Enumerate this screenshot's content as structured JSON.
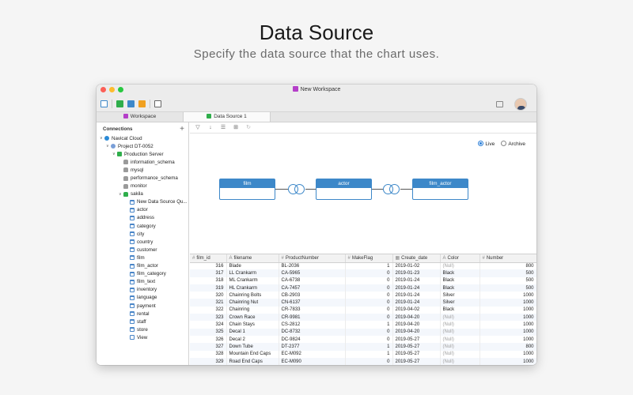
{
  "hero": {
    "title": "Data Source",
    "subtitle": "Specify the data source that the chart uses."
  },
  "window": {
    "title": "New Workspace",
    "tabs": [
      {
        "label": "Workspace",
        "icon": "workspace-icon",
        "color": "#b53fc9"
      },
      {
        "label": "Data Source 1",
        "icon": "data-source-icon",
        "color": "#2fae4b"
      }
    ]
  },
  "sidebar": {
    "header": "Connections",
    "add_label": "+",
    "tree": [
      {
        "label": "Navicat Cloud",
        "icon": "cloud-icon",
        "level": 0,
        "expanded": true
      },
      {
        "label": "Project DT-0052",
        "icon": "project-icon",
        "level": 1,
        "expanded": true
      },
      {
        "label": "Production Server",
        "icon": "server-icon",
        "level": 2,
        "expanded": true
      },
      {
        "label": "information_schema",
        "icon": "database-icon",
        "level": 3
      },
      {
        "label": "mysql",
        "icon": "database-icon",
        "level": 3
      },
      {
        "label": "performance_schema",
        "icon": "database-icon",
        "level": 3
      },
      {
        "label": "monitor",
        "icon": "database-icon",
        "level": 3
      },
      {
        "label": "sakila",
        "icon": "database-open-icon",
        "level": 3,
        "expanded": true
      },
      {
        "label": "New Data Source Qu...",
        "icon": "query-icon",
        "level": 4
      },
      {
        "label": "actor",
        "icon": "table-icon",
        "level": 4
      },
      {
        "label": "address",
        "icon": "table-icon",
        "level": 4
      },
      {
        "label": "category",
        "icon": "table-icon",
        "level": 4
      },
      {
        "label": "city",
        "icon": "table-icon",
        "level": 4
      },
      {
        "label": "country",
        "icon": "table-icon",
        "level": 4
      },
      {
        "label": "customer",
        "icon": "table-icon",
        "level": 4
      },
      {
        "label": "film",
        "icon": "table-icon",
        "level": 4
      },
      {
        "label": "film_actor",
        "icon": "table-icon",
        "level": 4
      },
      {
        "label": "film_category",
        "icon": "table-icon",
        "level": 4
      },
      {
        "label": "film_text",
        "icon": "table-icon",
        "level": 4
      },
      {
        "label": "inventory",
        "icon": "table-icon",
        "level": 4
      },
      {
        "label": "language",
        "icon": "table-icon",
        "level": 4
      },
      {
        "label": "payment",
        "icon": "table-icon",
        "level": 4
      },
      {
        "label": "rental",
        "icon": "table-icon",
        "level": 4
      },
      {
        "label": "staff",
        "icon": "table-icon",
        "level": 4
      },
      {
        "label": "store",
        "icon": "table-icon",
        "level": 4
      },
      {
        "label": "View",
        "icon": "view-icon",
        "level": 4
      }
    ]
  },
  "mode": {
    "live_label": "Live",
    "archive_label": "Archive",
    "selected": "Live"
  },
  "diagram": {
    "entities": [
      "film",
      "actor",
      "film_actor"
    ]
  },
  "grid": {
    "columns": [
      {
        "label": "film_id",
        "icon": "#"
      },
      {
        "label": "filename",
        "icon": "A"
      },
      {
        "label": "ProductNumber",
        "icon": "#"
      },
      {
        "label": "MakeFlag",
        "icon": "#"
      },
      {
        "label": "Create_date",
        "icon": "▦"
      },
      {
        "label": "Color",
        "icon": "A"
      },
      {
        "label": "Number",
        "icon": "#"
      }
    ],
    "rows": [
      [
        "316",
        "Blade",
        "BL-2036",
        "1",
        "2019-01-02",
        "(Null)",
        "800"
      ],
      [
        "317",
        "LL Crankarm",
        "CA-5965",
        "0",
        "2019-01-23",
        "Black",
        "500"
      ],
      [
        "318",
        "ML Crankarm",
        "CA-6738",
        "0",
        "2019-01-24",
        "Black",
        "500"
      ],
      [
        "319",
        "HL Crankarm",
        "CA-7457",
        "0",
        "2019-01-24",
        "Black",
        "500"
      ],
      [
        "320",
        "Chainring Bolts",
        "CB-2903",
        "0",
        "2019-01-24",
        "Silver",
        "1000"
      ],
      [
        "321",
        "Chainring Nut",
        "CN-6137",
        "0",
        "2019-01-24",
        "Silver",
        "1000"
      ],
      [
        "322",
        "Chainring",
        "CR-7833",
        "0",
        "2019-04-02",
        "Black",
        "1000"
      ],
      [
        "323",
        "Crown Race",
        "CR-9981",
        "0",
        "2019-04-20",
        "(Null)",
        "1000"
      ],
      [
        "324",
        "Chain Stays",
        "CS-2812",
        "1",
        "2019-04-20",
        "(Null)",
        "1000"
      ],
      [
        "325",
        "Decal 1",
        "DC-8732",
        "0",
        "2019-04-20",
        "(Null)",
        "1000"
      ],
      [
        "326",
        "Decal 2",
        "DC-9824",
        "0",
        "2019-05-27",
        "(Null)",
        "1000"
      ],
      [
        "327",
        "Down Tube",
        "DT-2377",
        "1",
        "2019-05-27",
        "(Null)",
        "800"
      ],
      [
        "328",
        "Mountain End Caps",
        "EC-M092",
        "1",
        "2019-05-27",
        "(Null)",
        "1000"
      ],
      [
        "329",
        "Road End Caps",
        "EC-M090",
        "0",
        "2019-05-27",
        "(Null)",
        "1000"
      ]
    ]
  }
}
